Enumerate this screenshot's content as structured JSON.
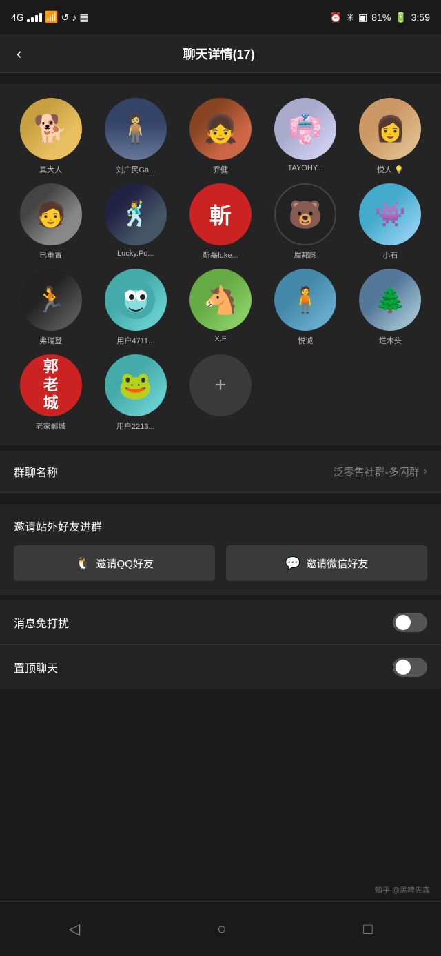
{
  "statusBar": {
    "signal": "4G",
    "wifi": "WiFi",
    "battery": "81%",
    "time": "3:59"
  },
  "header": {
    "backLabel": "‹",
    "title": "聊天详情(17)"
  },
  "members": [
    {
      "id": 1,
      "name": "真大人",
      "avatarClass": "shiba-avatar",
      "emoji": "🐕"
    },
    {
      "id": 2,
      "name": "刘广民Ga...",
      "avatarClass": "person-avatar",
      "emoji": "👤"
    },
    {
      "id": 3,
      "name": "乔健",
      "avatarClass": "girl-avatar",
      "emoji": "👧"
    },
    {
      "id": 4,
      "name": "TAYOHY...",
      "avatarClass": "hanfu-avatar",
      "emoji": "👘"
    },
    {
      "id": 5,
      "name": "悦人 💡",
      "avatarClass": "vintage-avatar",
      "emoji": "👩"
    },
    {
      "id": 6,
      "name": "已重置",
      "avatarClass": "hat-avatar",
      "emoji": "🎩"
    },
    {
      "id": 7,
      "name": "Lucky.Po...",
      "avatarClass": "dance-avatar",
      "emoji": "🕺"
    },
    {
      "id": 8,
      "name": "靳磊luke...",
      "avatarClass": "kanji-avatar",
      "emoji": "斬"
    },
    {
      "id": 9,
      "name": "魔都圆",
      "avatarClass": "bear-avatar",
      "emoji": "🐻"
    },
    {
      "id": 10,
      "name": "小石",
      "avatarClass": "alien-avatar",
      "emoji": "👾"
    },
    {
      "id": 11,
      "name": "弗瑞登",
      "avatarClass": "running-avatar",
      "emoji": "🏃"
    },
    {
      "id": 12,
      "name": "用户4711...",
      "avatarClass": "monster-avatar",
      "emoji": "👾"
    },
    {
      "id": 13,
      "name": "X.F",
      "avatarClass": "horse-avatar",
      "emoji": "🐴"
    },
    {
      "id": 14,
      "name": "悦诚",
      "avatarClass": "field-avatar",
      "emoji": "👤"
    },
    {
      "id": 15,
      "name": "烂木头",
      "avatarClass": "outdoor-avatar",
      "emoji": "🌲"
    },
    {
      "id": 16,
      "name": "老家郸城",
      "avatarClass": "郭-avatar",
      "emoji": "郭"
    },
    {
      "id": 17,
      "name": "用户2213...",
      "avatarClass": "frog-avatar",
      "emoji": "🐸"
    }
  ],
  "addButton": {
    "label": "+"
  },
  "settings": {
    "groupName": {
      "label": "群聊名称",
      "value": "泛零售社群-多闪群"
    },
    "inviteTitle": "邀请站外好友进群",
    "inviteQQ": "邀请QQ好友",
    "inviteWeChat": "邀请微信好友",
    "doNotDisturb": {
      "label": "消息免打扰",
      "enabled": false
    },
    "pinChat": {
      "label": "置顶聊天",
      "enabled": false
    }
  },
  "bottomNav": {
    "back": "◁",
    "home": "○",
    "recents": "□"
  },
  "watermark": "知乎 @黑啤先森"
}
